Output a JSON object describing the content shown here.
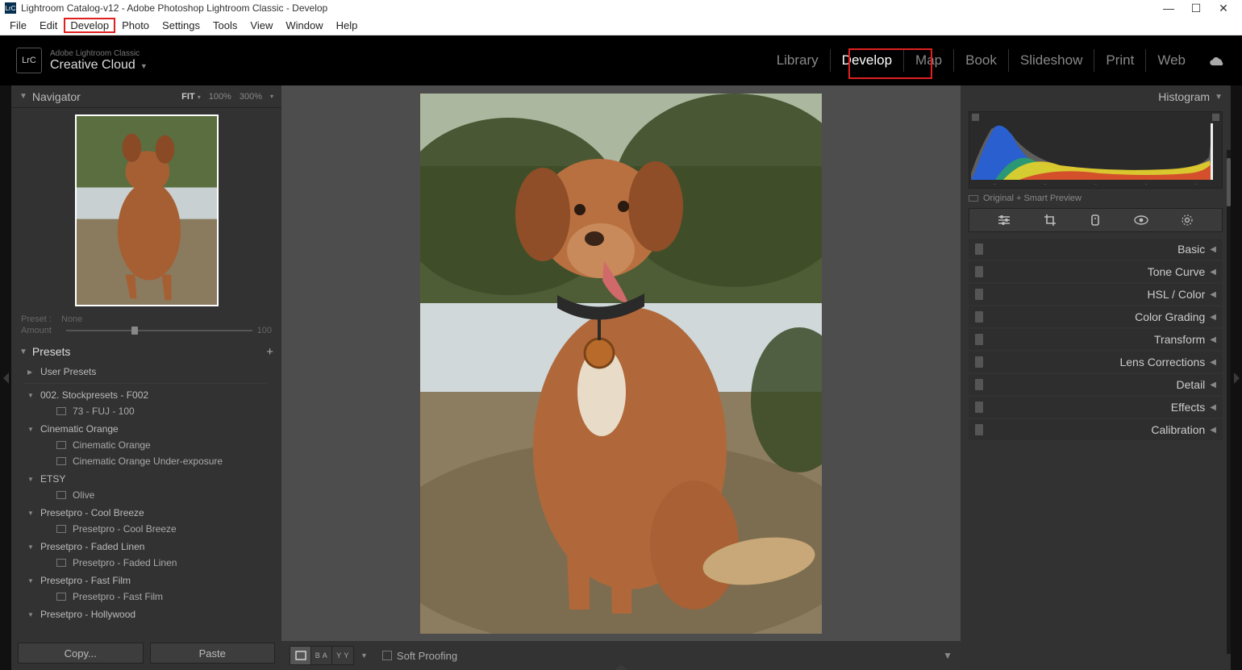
{
  "window": {
    "title": "Lightroom Catalog-v12 - Adobe Photoshop Lightroom Classic - Develop",
    "app_icon_text": "LrC"
  },
  "menubar": [
    "File",
    "Edit",
    "Develop",
    "Photo",
    "Settings",
    "Tools",
    "View",
    "Window",
    "Help"
  ],
  "menubar_highlight_index": 2,
  "top": {
    "logo_text": "LrC",
    "line1": "Adobe Lightroom Classic",
    "line2": "Creative Cloud",
    "modules": [
      "Library",
      "Develop",
      "Map",
      "Book",
      "Slideshow",
      "Print",
      "Web"
    ],
    "active_module_index": 1
  },
  "navigator": {
    "title": "Navigator",
    "zoom_options": [
      "FIT",
      "100%",
      "300%"
    ],
    "preset_label": "Preset :",
    "preset_value": "None",
    "amount_label": "Amount",
    "amount_value": "100"
  },
  "presets": {
    "title": "Presets",
    "groups": [
      {
        "name": "User Presets",
        "open": false,
        "items": []
      },
      {
        "name": "002. Stockpresets - F002",
        "open": true,
        "items": [
          "73 - FUJ - 100"
        ]
      },
      {
        "name": "Cinematic Orange",
        "open": true,
        "items": [
          "Cinematic Orange",
          "Cinematic Orange Under-exposure"
        ]
      },
      {
        "name": "ETSY",
        "open": true,
        "items": [
          "Olive"
        ]
      },
      {
        "name": "Presetpro - Cool Breeze",
        "open": true,
        "items": [
          "Presetpro - Cool Breeze"
        ]
      },
      {
        "name": "Presetpro - Faded Linen",
        "open": true,
        "items": [
          "Presetpro - Faded Linen"
        ]
      },
      {
        "name": "Presetpro - Fast Film",
        "open": true,
        "items": [
          "Presetpro - Fast Film"
        ]
      },
      {
        "name": "Presetpro - Hollywood",
        "open": true,
        "items": []
      }
    ],
    "copy_label": "Copy...",
    "paste_label": "Paste"
  },
  "center": {
    "soft_proofing_label": "Soft Proofing"
  },
  "right": {
    "histogram_title": "Histogram",
    "original_preview_label": "Original + Smart Preview",
    "tools": [
      "edit-icon",
      "crop-icon",
      "heal-icon",
      "redeye-icon",
      "mask-icon"
    ],
    "panels": [
      "Basic",
      "Tone Curve",
      "HSL / Color",
      "Color Grading",
      "Transform",
      "Lens Corrections",
      "Detail",
      "Effects",
      "Calibration"
    ]
  }
}
